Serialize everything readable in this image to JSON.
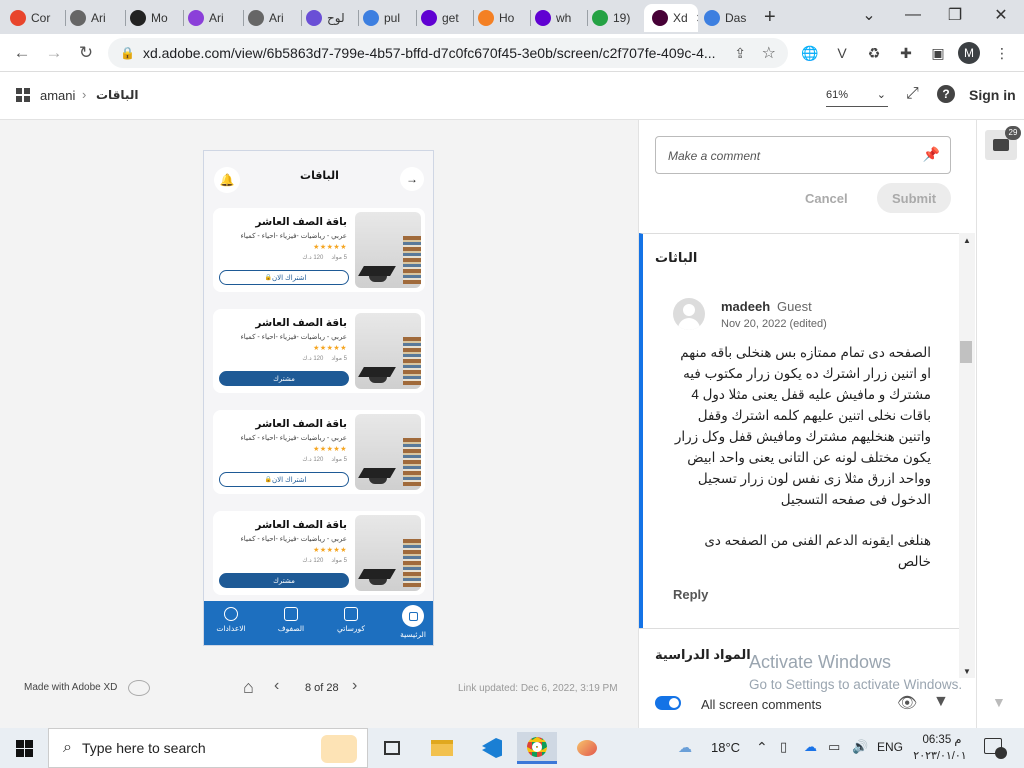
{
  "browser": {
    "tabs": [
      {
        "label": "Cor",
        "color": "#e8452c"
      },
      {
        "label": "Ari",
        "color": "#666666"
      },
      {
        "label": "Mo",
        "color": "#222222"
      },
      {
        "label": "Ari",
        "color": "#8b3fd9"
      },
      {
        "label": "Ari",
        "color": "#666666"
      },
      {
        "label": "لوح",
        "color": "#6a4fd6"
      },
      {
        "label": "pul",
        "color": "#3d7fe0"
      },
      {
        "label": "get",
        "color": "#6001d2"
      },
      {
        "label": "Ho",
        "color": "#f48024"
      },
      {
        "label": "wh",
        "color": "#6001d2"
      },
      {
        "label": "19)",
        "color": "#25a244"
      },
      {
        "label": "Xd",
        "color": "#470137"
      },
      {
        "label": "Das",
        "color": "#3d7fe0"
      }
    ],
    "new_tab": "+",
    "url": "xd.adobe.com/view/6b5863d7-799e-4b57-bffd-d7c0fc670f45-3e0b/screen/c2f707fe-409c-4...",
    "profile_initial": "M"
  },
  "xd": {
    "breadcrumb_user": "amani",
    "breadcrumb_page": "الباقات",
    "zoom": "61%",
    "sign_in": "Sign in",
    "made_with": "Made with Adobe XD",
    "pager": "8 of 28",
    "link_updated": "Link updated: Dec 6, 2022, 3:19 PM"
  },
  "phone": {
    "title": "الباقات",
    "cards": [
      {
        "title": "باقة الصف العاشر",
        "subtitle": "عربي - رياضيات -فيزياء -احياء - كمياء",
        "stars": "★★★★★",
        "materials": "5 مواد",
        "price": "120 د.ك",
        "button": "اشتراك الان",
        "style": "outline"
      },
      {
        "title": "باقة الصف العاشر",
        "subtitle": "عربي - رياضيات -فيزياء -احياء - كمياء",
        "stars": "★★★★★",
        "materials": "5 مواد",
        "price": "120 د.ك",
        "button": "مشترك",
        "style": "filled"
      },
      {
        "title": "باقة الصف العاشر",
        "subtitle": "عربي - رياضيات -فيزياء -احياء - كمياء",
        "stars": "★★★★★",
        "materials": "5 مواد",
        "price": "120 د.ك",
        "button": "اشتراك الان",
        "style": "outline"
      },
      {
        "title": "باقة الصف العاشر",
        "subtitle": "عربي - رياضيات -فيزياء -احياء - كمياء",
        "stars": "★★★★★",
        "materials": "5 مواد",
        "price": "120 د.ك",
        "button": "مشترك",
        "style": "filled"
      }
    ],
    "nav": [
      "الرئيسية",
      "كورساتي",
      "الصفوف",
      "الاعدادات"
    ]
  },
  "comments": {
    "placeholder": "Make a comment",
    "cancel": "Cancel",
    "submit": "Submit",
    "section_title": "الباثات",
    "author": "madeeh",
    "author_role": "Guest",
    "date": "Nov 20, 2022 (edited)",
    "body": "الصفحه دى تمام ممتازه بس هنخلى باقه منهم او اتنين زرار اشترك ده يكون زرار مكتوب فيه مشترك و مافيش عليه قفل يعنى مثلا دول 4 باقات نخلى اتنين عليهم كلمه اشترك وقفل واتنين هنخليهم مشترك ومافيش قفل  وكل زرار يكون مختلف لونه عن التانى يعنى واحد ابيض وواحد ازرق مثلا زى نفس لون زرار تسجيل الدخول فى صفحه التسجيل",
    "body2": "هنلغى ايقونه الدعم الفنى من الصفحه دى خالص",
    "reply": "Reply",
    "next_section": "المواد الدراسية",
    "toggle_label": "All screen comments",
    "badge_count": "29",
    "watermark_title": "Activate Windows",
    "watermark_sub": "Go to Settings to activate Windows."
  },
  "taskbar": {
    "search_placeholder": "Type here to search",
    "weather": "18°C",
    "lang": "ENG",
    "time": "06:35 م",
    "date": "٢٠٢٣/٠١/٠١"
  }
}
